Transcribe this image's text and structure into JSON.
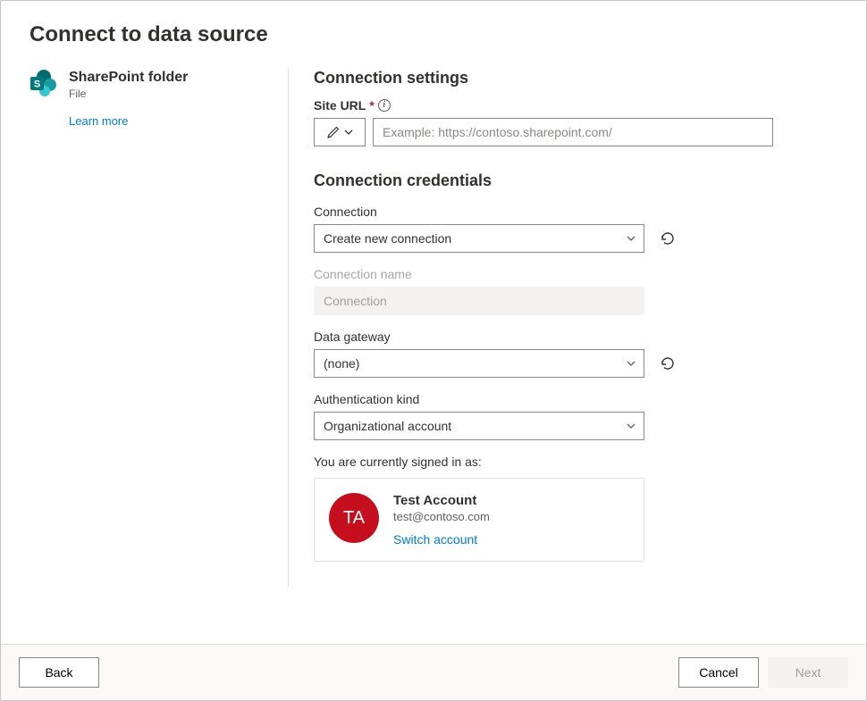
{
  "page_title": "Connect to data source",
  "source": {
    "name": "SharePoint folder",
    "category": "File",
    "learn_more": "Learn more"
  },
  "settings": {
    "heading": "Connection settings",
    "site_url_label": "Site URL",
    "site_url_placeholder": "Example: https://contoso.sharepoint.com/"
  },
  "credentials": {
    "heading": "Connection credentials",
    "connection_label": "Connection",
    "connection_value": "Create new connection",
    "connection_name_label": "Connection name",
    "connection_name_value": "Connection",
    "gateway_label": "Data gateway",
    "gateway_value": "(none)",
    "auth_label": "Authentication kind",
    "auth_value": "Organizational account",
    "signed_in_text": "You are currently signed in as:",
    "account": {
      "initials": "TA",
      "name": "Test Account",
      "email": "test@contoso.com",
      "switch_label": "Switch account"
    }
  },
  "footer": {
    "back": "Back",
    "cancel": "Cancel",
    "next": "Next"
  }
}
